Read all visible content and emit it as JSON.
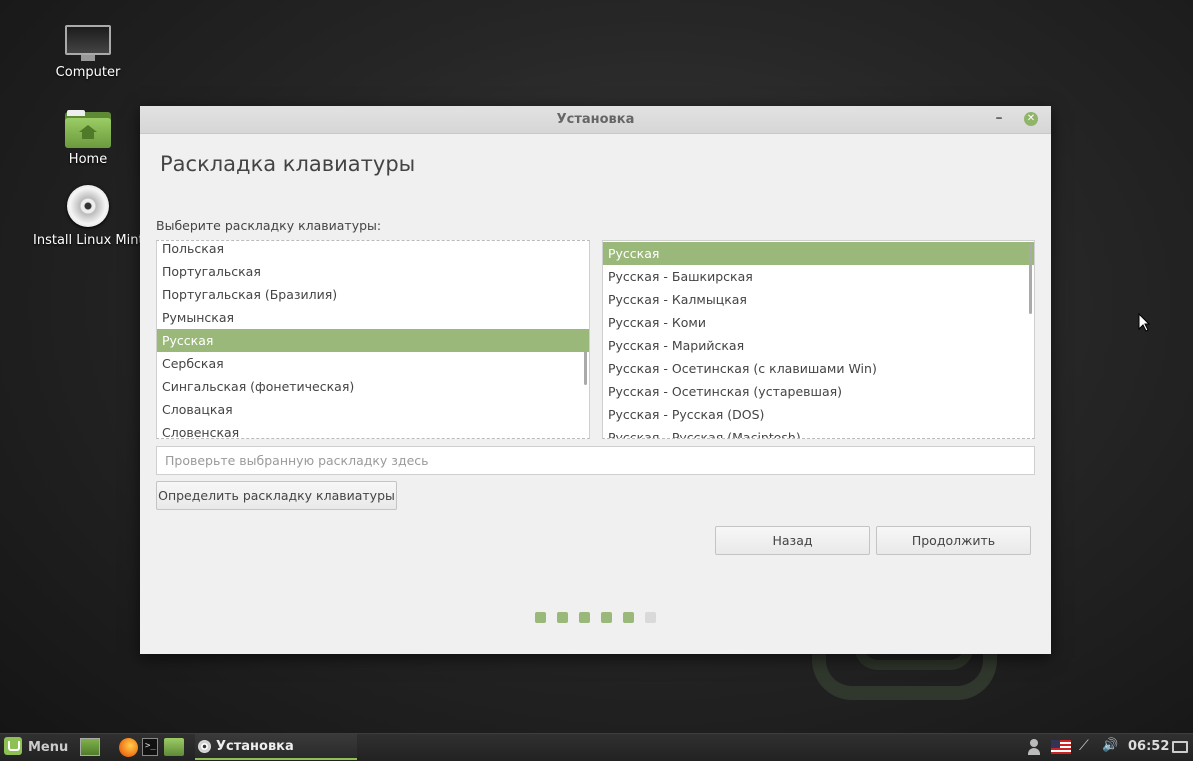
{
  "desktop": {
    "icons": [
      {
        "label": "Computer",
        "icon": "computer-icon"
      },
      {
        "label": "Home",
        "icon": "home-folder-icon"
      },
      {
        "label": "Install Linux Mint",
        "icon": "disc-icon"
      }
    ]
  },
  "window": {
    "title": "Установка",
    "minimize_glyph": "–",
    "close_glyph": "✕",
    "page_title": "Раскладка клавиатуры",
    "prompt": "Выберите раскладку клавиатуры:",
    "layouts": [
      "Польская",
      "Португальская",
      "Португальская (Бразилия)",
      "Румынская",
      "Русская",
      "Сербская",
      "Сингальская (фонетическая)",
      "Словацкая",
      "Словенская"
    ],
    "selected_layout_index": 4,
    "variants": [
      "Русская",
      "Русская - Башкирская",
      "Русская - Калмыцкая",
      "Русская - Коми",
      "Русская - Марийская",
      "Русская - Осетинская (с клавишами Win)",
      "Русская - Осетинская (устаревшая)",
      "Русская - Русская (DOS)",
      "Русская - Русская (Macintosh)"
    ],
    "selected_variant_index": 0,
    "test_input": {
      "value": "",
      "placeholder": "Проверьте выбранную раскладку здесь"
    },
    "detect_button": "Определить раскладку клавиатуры",
    "back_button": "Назад",
    "continue_button": "Продолжить",
    "progress": {
      "completed_steps": 5,
      "total_steps": 6
    },
    "accent_color": "#9ab87a"
  },
  "taskbar": {
    "menu_label": "Menu",
    "task_label": "Установка",
    "clock": "06:52",
    "launchers": [
      "show-desktop-icon",
      "firefox-icon",
      "terminal-icon",
      "files-icon"
    ],
    "tray": [
      "user-icon",
      "keyboard-flag-icon",
      "network-icon",
      "volume-icon",
      "display-icon"
    ],
    "terminal_glyph": ">_",
    "network_glyph": "⟋",
    "volume_glyph": "🔊"
  }
}
